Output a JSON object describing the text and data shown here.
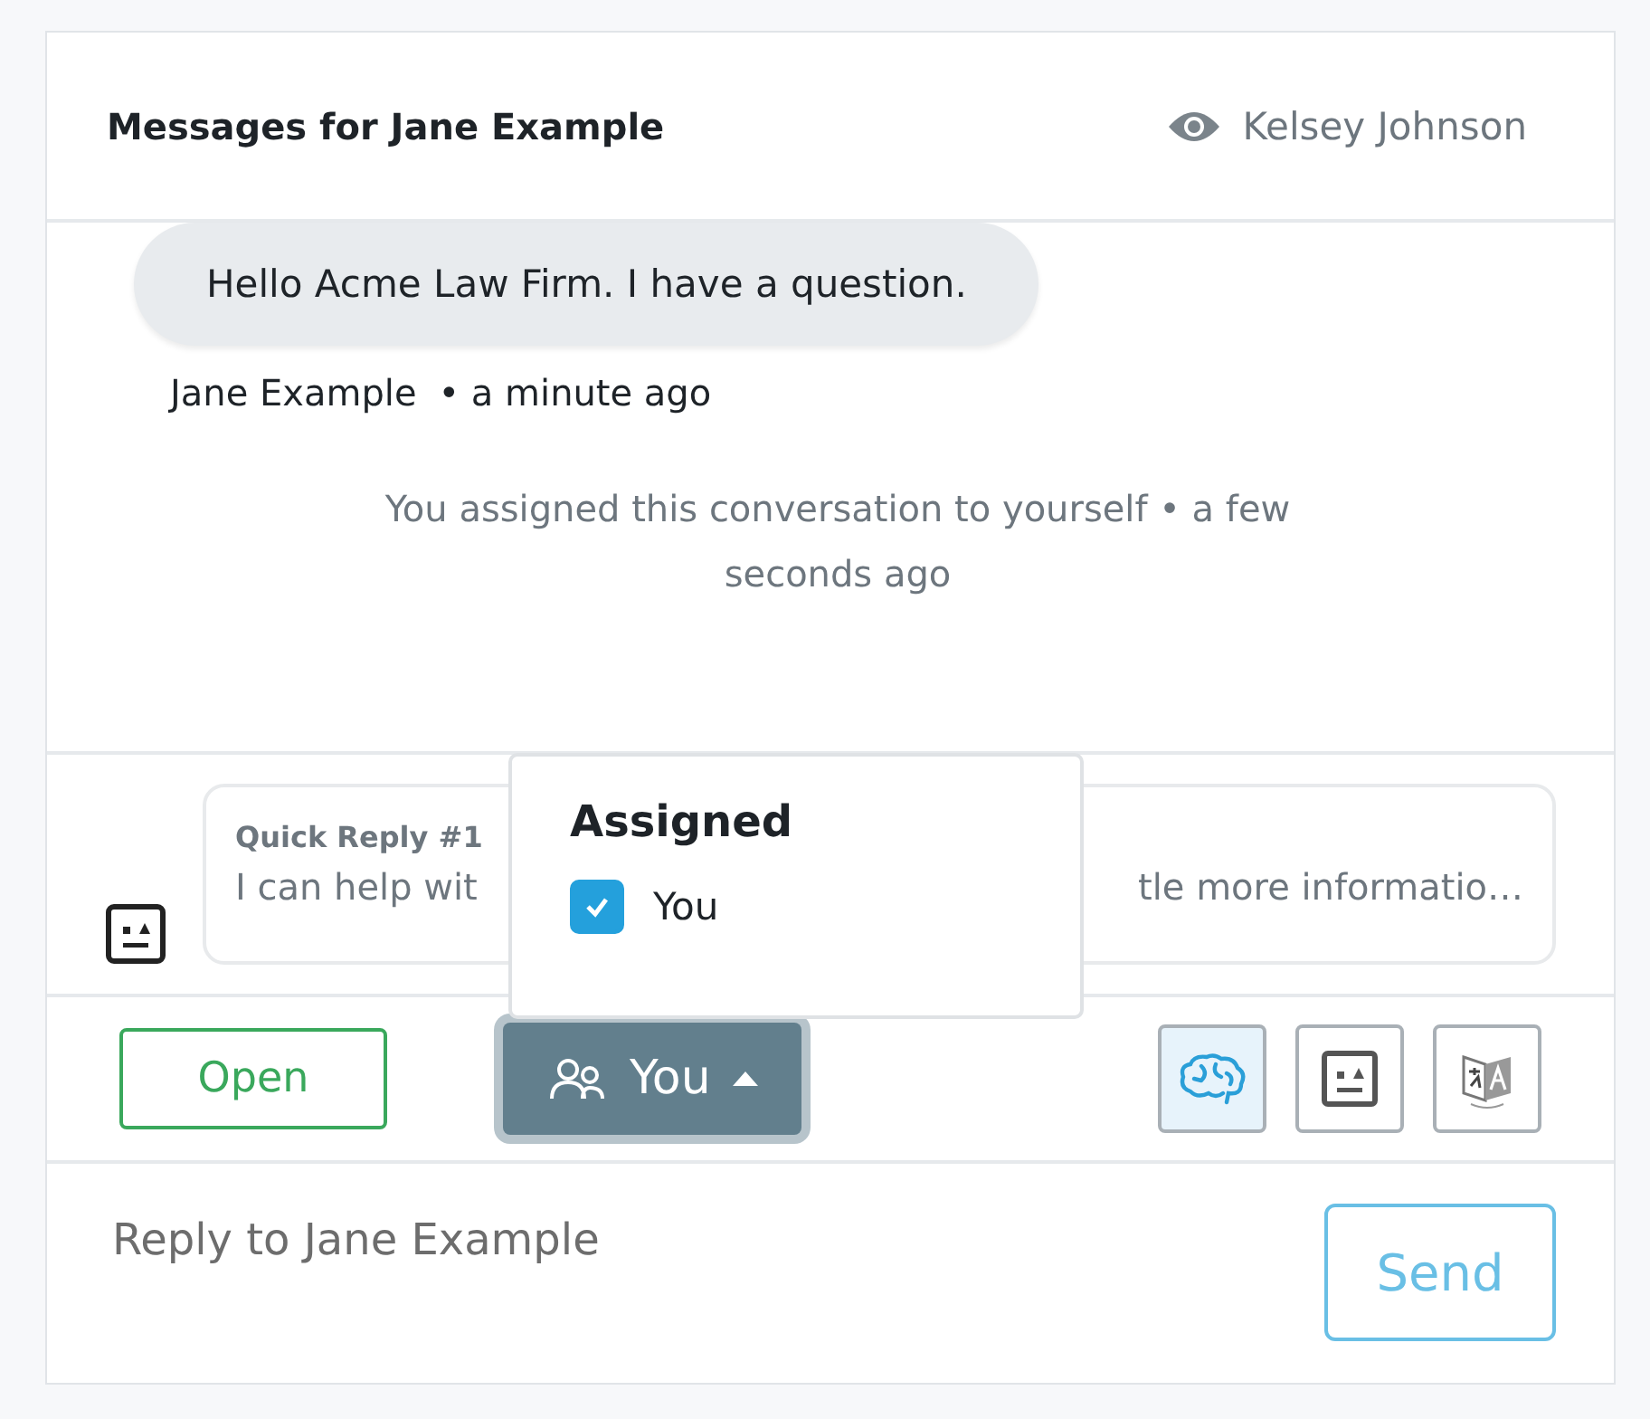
{
  "header": {
    "title": "Messages for Jane Example",
    "viewer": "Kelsey Johnson"
  },
  "messages": [
    {
      "kind": "bubble",
      "text": "Hello Acme Law Firm. I have a question.",
      "author": "Jane Example",
      "time": "• a minute ago"
    },
    {
      "kind": "event",
      "text": "You assigned this conversation to yourself • a few seconds ago"
    }
  ],
  "quick_reply": {
    "title": "Quick Reply #1",
    "text_start": "I can help wit",
    "text_end": "tle more informatio…"
  },
  "assign_menu": {
    "heading": "Assigned",
    "options": [
      {
        "label": "You",
        "checked": true
      }
    ]
  },
  "toolbar": {
    "status_button": "Open",
    "assignee_button": {
      "label": "You",
      "expanded": true
    },
    "tools": [
      {
        "kind": "brain",
        "selected": true
      },
      {
        "kind": "robot",
        "selected": false
      },
      {
        "kind": "translate",
        "selected": false
      }
    ]
  },
  "reply": {
    "placeholder": "Reply to Jane Example",
    "send": "Send"
  }
}
